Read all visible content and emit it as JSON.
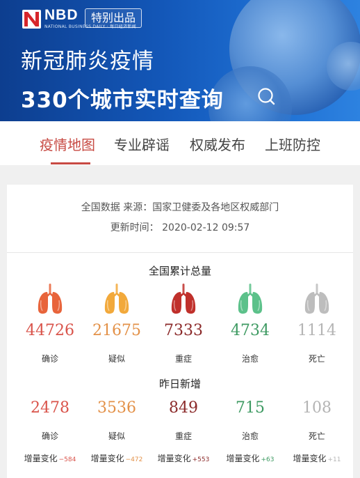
{
  "banner": {
    "logo": "NBD",
    "logo_sub": "NATIONAL BUSINESS DAILY · 每日经济新闻",
    "badge": "特别出品",
    "title_line1": "新冠肺炎疫情",
    "title_line2": "330个城市实时查询",
    "icon": "search-icon",
    "bg_color": "#1357b8"
  },
  "tabs": [
    {
      "label": "疫情地图",
      "active": true
    },
    {
      "label": "专业辟谣",
      "active": false
    },
    {
      "label": "权威发布",
      "active": false
    },
    {
      "label": "上班防控",
      "active": false
    }
  ],
  "info": {
    "source": "全国数据 来源：国家卫健委及各地区权威部门",
    "updated": "更新时间：  2020-02-12 09:57"
  },
  "totals": {
    "title": "全国累计总量",
    "items": [
      {
        "value": "44726",
        "label": "确诊",
        "color": "#d9534a",
        "icon": "lung-icon",
        "icon_color": "#e8643b"
      },
      {
        "value": "21675",
        "label": "疑似",
        "color": "#e39148",
        "icon": "lung-icon",
        "icon_color": "#f2a93b"
      },
      {
        "value": "7333",
        "label": "重症",
        "color": "#8b2a2a",
        "icon": "lung-icon",
        "icon_color": "#c0302b"
      },
      {
        "value": "4734",
        "label": "治愈",
        "color": "#3e9a62",
        "icon": "lung-icon",
        "icon_color": "#5cc18a"
      },
      {
        "value": "1114",
        "label": "死亡",
        "color": "#b4b4b4",
        "icon": "lung-icon",
        "icon_color": "#bdbdbd"
      }
    ]
  },
  "yesterday": {
    "title": "昨日新增",
    "change_label": "增量变化",
    "items": [
      {
        "value": "2478",
        "label": "确诊",
        "color": "#d9534a",
        "delta": "−584",
        "delta_color": "#d9534a"
      },
      {
        "value": "3536",
        "label": "疑似",
        "color": "#e39148",
        "delta": "−472",
        "delta_color": "#e39148"
      },
      {
        "value": "849",
        "label": "重症",
        "color": "#8b2a2a",
        "delta": "+553",
        "delta_color": "#8b2a2a"
      },
      {
        "value": "715",
        "label": "治愈",
        "color": "#3e9a62",
        "delta": "+63",
        "delta_color": "#3e9a62"
      },
      {
        "value": "108",
        "label": "死亡",
        "color": "#b4b4b4",
        "delta": "+11",
        "delta_color": "#b4b4b4"
      }
    ]
  }
}
